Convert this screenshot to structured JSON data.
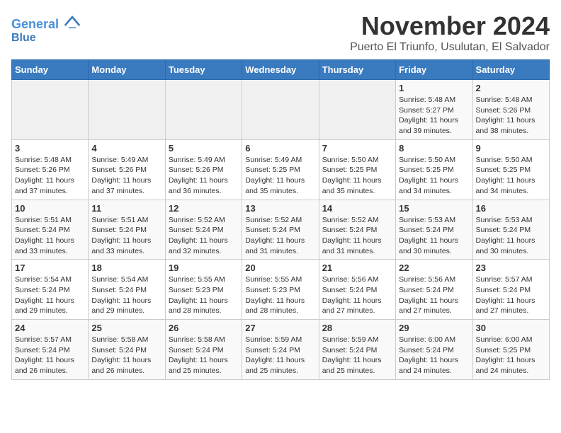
{
  "header": {
    "logo_line1": "General",
    "logo_line2": "Blue",
    "month_title": "November 2024",
    "subtitle": "Puerto El Triunfo, Usulutan, El Salvador"
  },
  "weekdays": [
    "Sunday",
    "Monday",
    "Tuesday",
    "Wednesday",
    "Thursday",
    "Friday",
    "Saturday"
  ],
  "weeks": [
    [
      {
        "day": "",
        "info": ""
      },
      {
        "day": "",
        "info": ""
      },
      {
        "day": "",
        "info": ""
      },
      {
        "day": "",
        "info": ""
      },
      {
        "day": "",
        "info": ""
      },
      {
        "day": "1",
        "info": "Sunrise: 5:48 AM\nSunset: 5:27 PM\nDaylight: 11 hours and 39 minutes."
      },
      {
        "day": "2",
        "info": "Sunrise: 5:48 AM\nSunset: 5:26 PM\nDaylight: 11 hours and 38 minutes."
      }
    ],
    [
      {
        "day": "3",
        "info": "Sunrise: 5:48 AM\nSunset: 5:26 PM\nDaylight: 11 hours and 37 minutes."
      },
      {
        "day": "4",
        "info": "Sunrise: 5:49 AM\nSunset: 5:26 PM\nDaylight: 11 hours and 37 minutes."
      },
      {
        "day": "5",
        "info": "Sunrise: 5:49 AM\nSunset: 5:26 PM\nDaylight: 11 hours and 36 minutes."
      },
      {
        "day": "6",
        "info": "Sunrise: 5:49 AM\nSunset: 5:25 PM\nDaylight: 11 hours and 35 minutes."
      },
      {
        "day": "7",
        "info": "Sunrise: 5:50 AM\nSunset: 5:25 PM\nDaylight: 11 hours and 35 minutes."
      },
      {
        "day": "8",
        "info": "Sunrise: 5:50 AM\nSunset: 5:25 PM\nDaylight: 11 hours and 34 minutes."
      },
      {
        "day": "9",
        "info": "Sunrise: 5:50 AM\nSunset: 5:25 PM\nDaylight: 11 hours and 34 minutes."
      }
    ],
    [
      {
        "day": "10",
        "info": "Sunrise: 5:51 AM\nSunset: 5:24 PM\nDaylight: 11 hours and 33 minutes."
      },
      {
        "day": "11",
        "info": "Sunrise: 5:51 AM\nSunset: 5:24 PM\nDaylight: 11 hours and 33 minutes."
      },
      {
        "day": "12",
        "info": "Sunrise: 5:52 AM\nSunset: 5:24 PM\nDaylight: 11 hours and 32 minutes."
      },
      {
        "day": "13",
        "info": "Sunrise: 5:52 AM\nSunset: 5:24 PM\nDaylight: 11 hours and 31 minutes."
      },
      {
        "day": "14",
        "info": "Sunrise: 5:52 AM\nSunset: 5:24 PM\nDaylight: 11 hours and 31 minutes."
      },
      {
        "day": "15",
        "info": "Sunrise: 5:53 AM\nSunset: 5:24 PM\nDaylight: 11 hours and 30 minutes."
      },
      {
        "day": "16",
        "info": "Sunrise: 5:53 AM\nSunset: 5:24 PM\nDaylight: 11 hours and 30 minutes."
      }
    ],
    [
      {
        "day": "17",
        "info": "Sunrise: 5:54 AM\nSunset: 5:24 PM\nDaylight: 11 hours and 29 minutes."
      },
      {
        "day": "18",
        "info": "Sunrise: 5:54 AM\nSunset: 5:24 PM\nDaylight: 11 hours and 29 minutes."
      },
      {
        "day": "19",
        "info": "Sunrise: 5:55 AM\nSunset: 5:23 PM\nDaylight: 11 hours and 28 minutes."
      },
      {
        "day": "20",
        "info": "Sunrise: 5:55 AM\nSunset: 5:23 PM\nDaylight: 11 hours and 28 minutes."
      },
      {
        "day": "21",
        "info": "Sunrise: 5:56 AM\nSunset: 5:24 PM\nDaylight: 11 hours and 27 minutes."
      },
      {
        "day": "22",
        "info": "Sunrise: 5:56 AM\nSunset: 5:24 PM\nDaylight: 11 hours and 27 minutes."
      },
      {
        "day": "23",
        "info": "Sunrise: 5:57 AM\nSunset: 5:24 PM\nDaylight: 11 hours and 27 minutes."
      }
    ],
    [
      {
        "day": "24",
        "info": "Sunrise: 5:57 AM\nSunset: 5:24 PM\nDaylight: 11 hours and 26 minutes."
      },
      {
        "day": "25",
        "info": "Sunrise: 5:58 AM\nSunset: 5:24 PM\nDaylight: 11 hours and 26 minutes."
      },
      {
        "day": "26",
        "info": "Sunrise: 5:58 AM\nSunset: 5:24 PM\nDaylight: 11 hours and 25 minutes."
      },
      {
        "day": "27",
        "info": "Sunrise: 5:59 AM\nSunset: 5:24 PM\nDaylight: 11 hours and 25 minutes."
      },
      {
        "day": "28",
        "info": "Sunrise: 5:59 AM\nSunset: 5:24 PM\nDaylight: 11 hours and 25 minutes."
      },
      {
        "day": "29",
        "info": "Sunrise: 6:00 AM\nSunset: 5:24 PM\nDaylight: 11 hours and 24 minutes."
      },
      {
        "day": "30",
        "info": "Sunrise: 6:00 AM\nSunset: 5:25 PM\nDaylight: 11 hours and 24 minutes."
      }
    ]
  ]
}
